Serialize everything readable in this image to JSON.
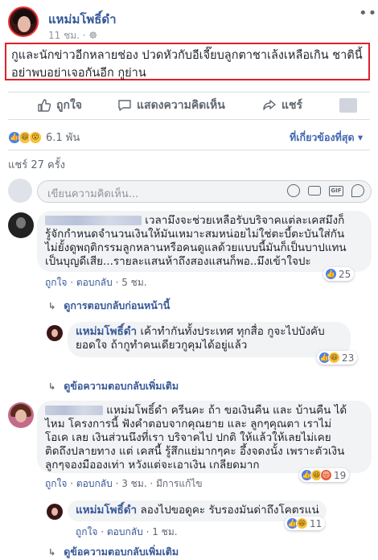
{
  "post": {
    "page_name": "แหม่มโพธิ์ดำ",
    "time": "11 ชม. · ☸",
    "text_line1": "กูและนักข่าวอีกหลายช่อง ปวดหัวกับอีเจี๊ยบลูกตาชาเล้งเหลือเกิน ชาตินี้",
    "text_line2": "อย่าพบอย่าเจอกันอีก กูย่าน",
    "actions": {
      "like": "ถูกใจ",
      "comment": "แสดงความคิดเห็น",
      "share": "แชร์"
    },
    "reaction_count": "6.1 พัน",
    "sort_label": "ที่เกี่ยวข้องที่สุด ▾",
    "share_count": "แชร์ 27 ครั้ง",
    "comment_placeholder": "เขียนความคิดเห็น..."
  },
  "comments": [
    {
      "text_line1": "เวลามึงจะช่วยเหลือรับบริจาคแต่ละเคสมึงก็",
      "text_line2": "รู้จักกำหนดจำนวนเงินให้มันเหมาะสมหน่อยไม่ใช่ตะบี้ตะบันใส่กัน",
      "text_line3": "ไม่ยั้งดูพฤติกรรมลูกหลานหรือคนดูแลด้วยแบบนี้มันก็เป็นบาปแทน",
      "text_line4": "เป็นบุญดีเสีย...รายละแสนห้าถึงสองแสนก็พอ..มึงเข้าใจปะ",
      "like": "ถูกใจ",
      "reply": "ตอบกลับ",
      "time": "5 ชม.",
      "count": "25",
      "prev_replies": "ดูการตอบกลับก่อนหน้านี้",
      "reply_item": {
        "name": "แหม่มโพธิ์ดำ",
        "text_line1": "เค้าทำกันทั้งประเทศ ทุกสื่อ กูจะไปบังคับ",
        "text_line2": "ยอดใจ ถ้ากูทำคนเดียวกูคุมได้อยู่แล้ว",
        "count": "23"
      },
      "more_replies": "ดูข้อความตอบกลับเพิ่มเติม"
    },
    {
      "text_line1": "แหม่มโพธิ์ดำ ครีนคะ ถ้า ขอเงินคืน และ บ้านคืน ได้",
      "text_line2": "ไหม โครงการนี้ ฟังคำตอบจากคุณยาย และ ลูกๆคุณตา เราไม่",
      "text_line3": "โอเค เลย เงินส่วนนึงที่เรา บริจาคไป ปกติ ให้แล้วให้เลยไม่เคย",
      "text_line4": "ติดถึงปลายทาง แต่ เคสนี้ รู้สึกแย่มากๆคะ อึ้งจดงนั้ง เพราะตัวเงิน",
      "text_line5": "ลูกๆจองมือองเท่า หวังแต่จะเอาเงิน เกลียดมาก",
      "like": "ถูกใจ",
      "reply": "ตอบกลับ",
      "time": "3 ชม.",
      "edited": "มีการแก้ไข",
      "count": "19",
      "reply_item": {
        "name": "แหม่มโพธิ์ดำ",
        "text": "ลองไปขอดูคะ รับรองมันด่าถึงโคตรแน่",
        "like": "ถูกใจ",
        "reply": "ตอบกลับ",
        "time": "1 ชม.",
        "count": "11"
      },
      "more_replies": "ดูข้อความตอบกลับเพิ่มเติม"
    }
  ],
  "colors": {
    "accent": "#4267b2",
    "link": "#385898",
    "highlight_border": "#e0202a"
  }
}
